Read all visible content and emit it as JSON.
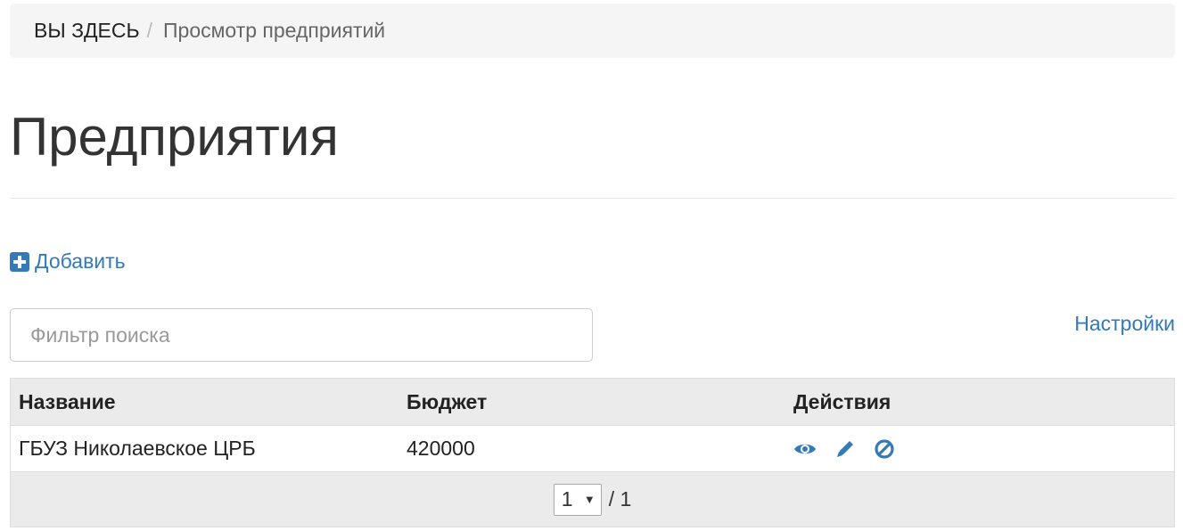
{
  "breadcrumb": {
    "first": "ВЫ ЗДЕСЬ",
    "separator": "/",
    "current": "Просмотр предприятий"
  },
  "page": {
    "title": "Предприятия",
    "add_label": "Добавить",
    "settings_label": "Настройки"
  },
  "search": {
    "placeholder": "Фильтр поиска",
    "value": ""
  },
  "table": {
    "headers": [
      "Название",
      "Бюджет",
      "Действия"
    ],
    "rows": [
      {
        "name": "ГБУЗ Николаевское ЦРБ",
        "budget": "420000",
        "actions": [
          "eye-icon",
          "pencil-icon",
          "ban-icon"
        ]
      }
    ]
  },
  "pagination": {
    "current_page": "1",
    "total_label": "/ 1"
  },
  "colors": {
    "link": "#337ab7",
    "breadcrumb_bg": "#f5f5f5",
    "table_header_bg": "#ebebeb"
  }
}
